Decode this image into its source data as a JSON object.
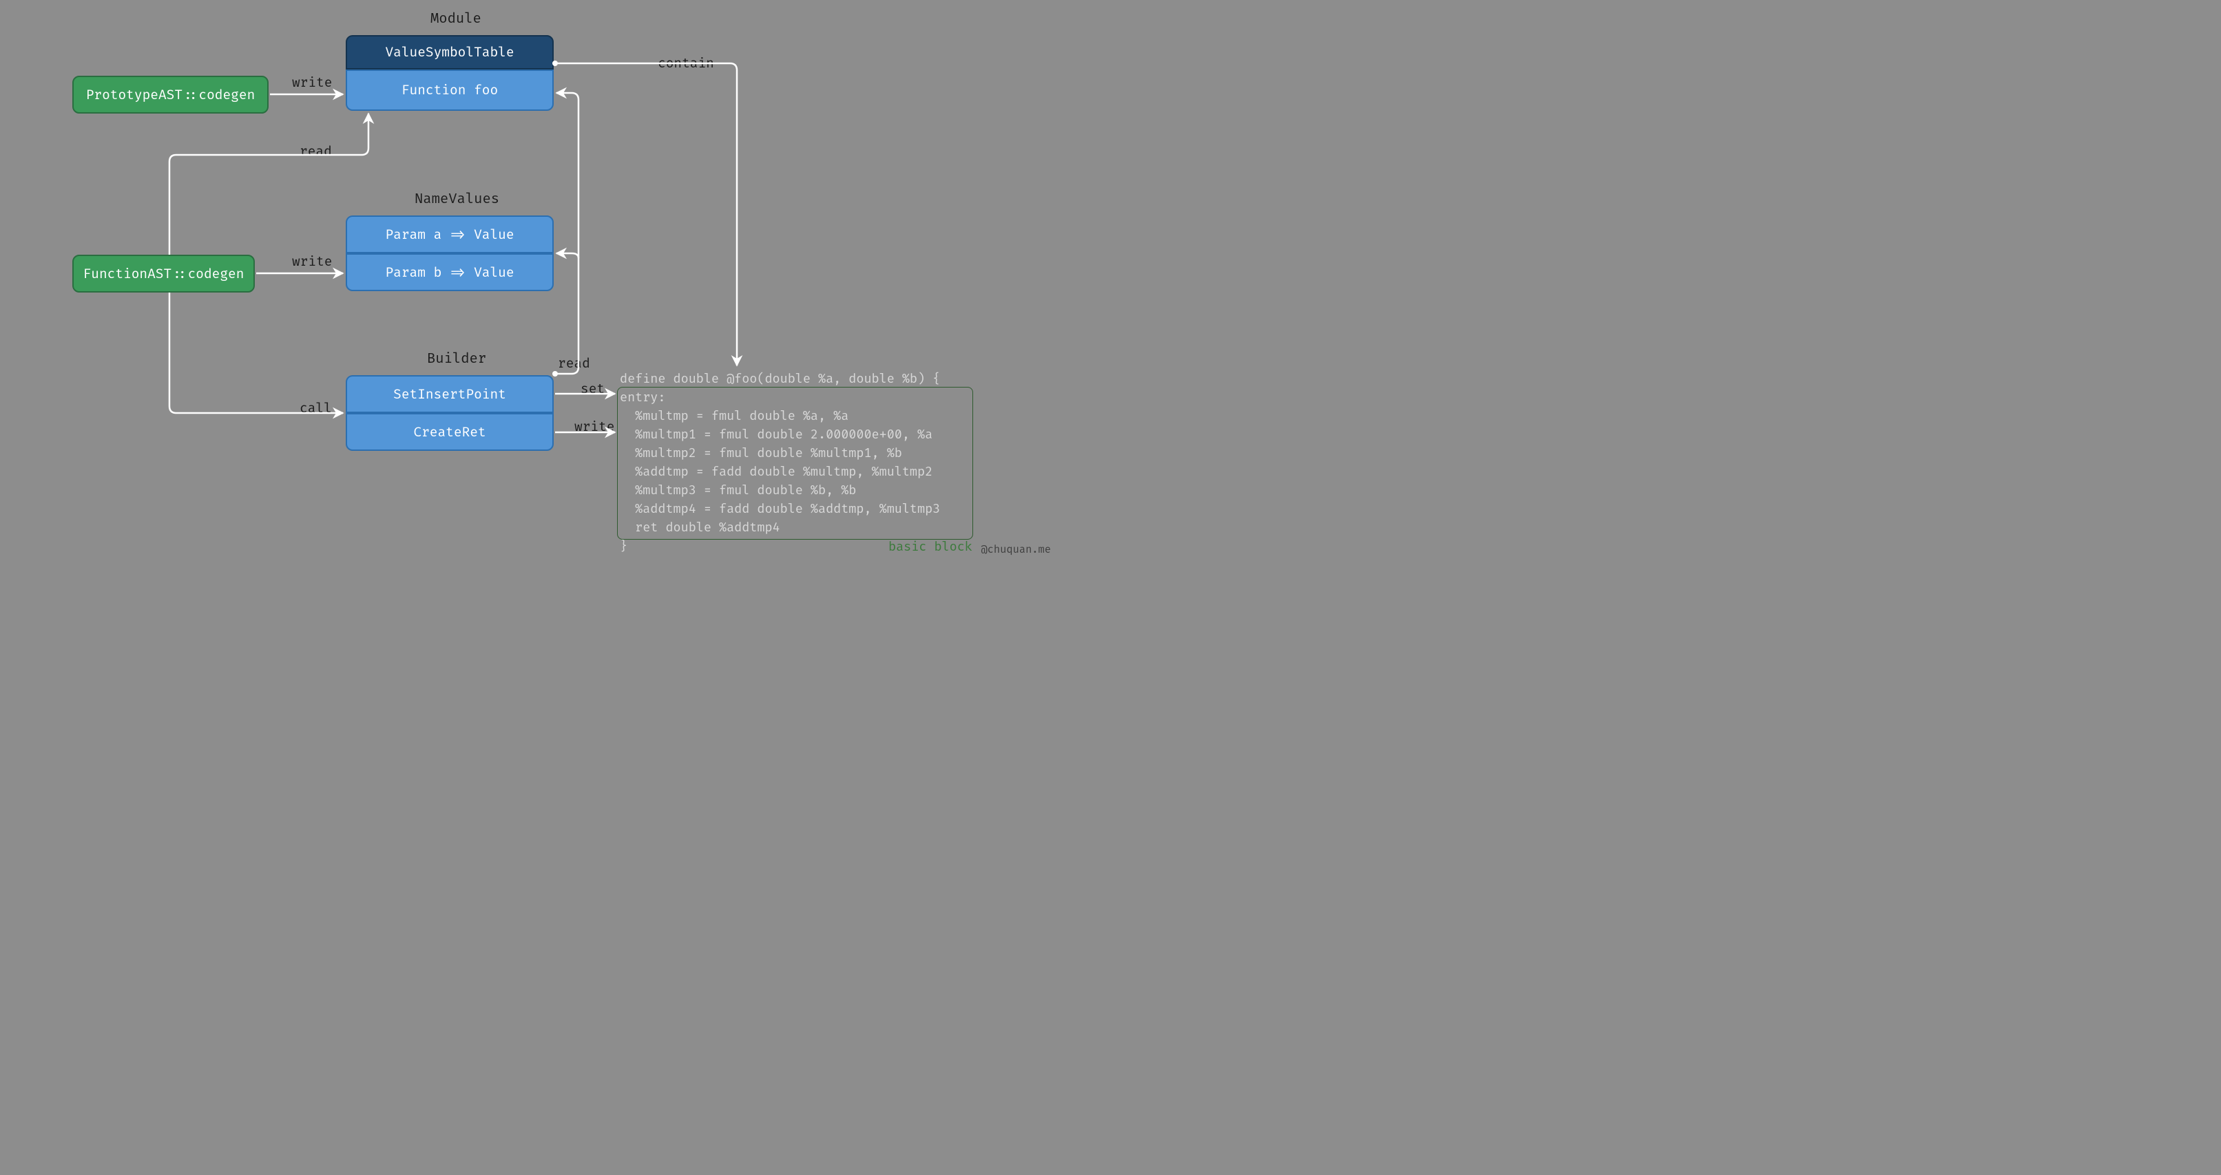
{
  "titles": {
    "module": "Module",
    "namevalues": "NameValues",
    "builder": "Builder"
  },
  "nodes": {
    "prototype": "PrototypeAST::codegen",
    "functionast": "FunctionAST::codegen",
    "vst": "ValueSymbolTable",
    "functionfoo": "Function foo",
    "param_a": "Param a => Value",
    "param_b": "Param b => Value",
    "setinsert": "SetInsertPoint",
    "createret": "CreateRet"
  },
  "edges": {
    "write1": "write",
    "read1": "read",
    "write2": "write",
    "call": "call",
    "set": "set",
    "write3": "write",
    "read2": "read",
    "contain": "contain"
  },
  "ir": {
    "define": "define double @foo(double %a, double %b) {",
    "entry": "entry:",
    "l1": "  %multmp = fmul double %a, %a",
    "l2": "  %multmp1 = fmul double 2.000000e+00, %a",
    "l3": "  %multmp2 = fmul double %multmp1, %b",
    "l4": "  %addtmp = fadd double %multmp, %multmp2",
    "l5": "  %multmp3 = fmul double %b, %b",
    "l6": "  %addtmp4 = fadd double %addtmp, %multmp3",
    "l7": "  ret double %addtmp4",
    "close": "}"
  },
  "bb_label": "basic block",
  "watermark": "@chuquan.me"
}
